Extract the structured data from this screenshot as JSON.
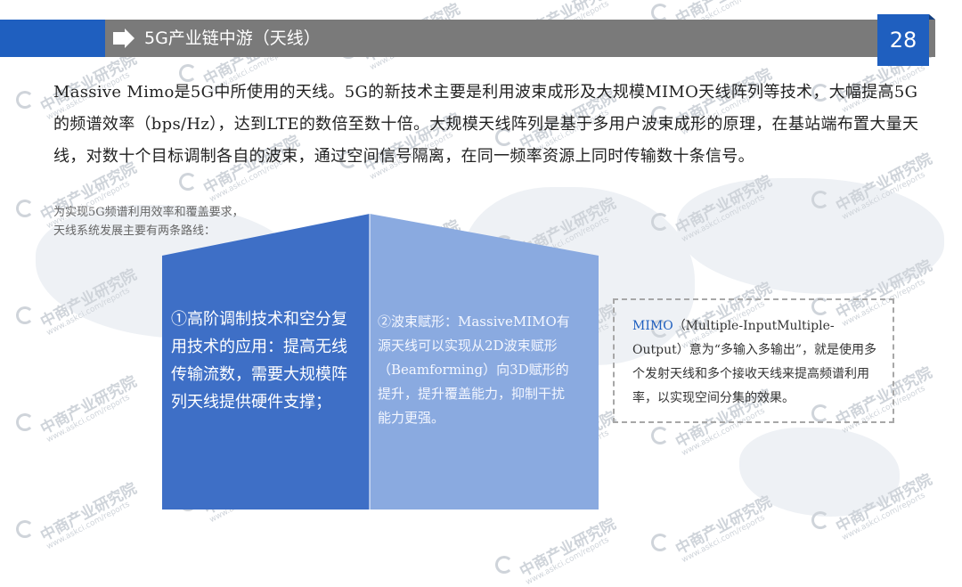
{
  "header": {
    "title": "5G产业链中游（天线）",
    "page_number": "28"
  },
  "intro": {
    "text": "Massive Mimo是5G中所使用的天线。5G的新技术主要是利用波束成形及大规模MIMO天线阵列等技术，大幅提高5G的频谱效率（bps/Hz），达到LTE的数倍至数十倍。大规模天线阵列是基于多用户波束成形的原理，在基站端布置大量天线，对数十个目标调制各自的波束，通过空间信号隔离，在同一频率资源上同时传输数十条信号。"
  },
  "note": {
    "line1": "为实现5G频谱利用效率和覆盖要求，",
    "line2": "天线系统发展主要有两条路线："
  },
  "routes": [
    {
      "text": "①高阶调制技术和空分复用技术的应用：提高无线传输流数，需要大规模阵列天线提供硬件支撑；"
    },
    {
      "text": "②波束赋形：MassiveMIMO有源天线可以实现从2D波束赋形（Beamforming）向3D赋形的提升，提升覆盖能力，抑制干扰能力更强。"
    }
  ],
  "mimo_box": {
    "highlight": "MIMO",
    "text": "（Multiple-InputMultiple-Output）意为“多输入多输出”，就是使用多个发射天线和多个接收天线来提高频谱利用率，以实现空间分集的效果。"
  },
  "watermark": {
    "brand": "中商产业研究院",
    "url": "www.askci.com/reports"
  },
  "colors": {
    "accent_blue": "#1f5fbf",
    "header_gray": "#7a7a7a",
    "cube_dark": "#3e6fc6",
    "cube_light": "#8aaae0"
  }
}
